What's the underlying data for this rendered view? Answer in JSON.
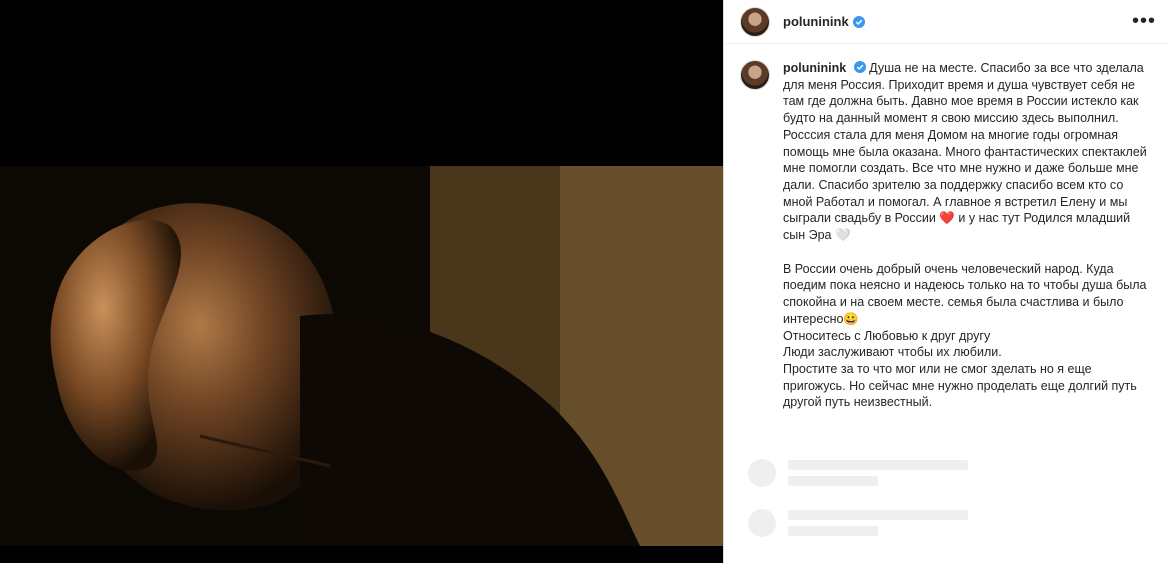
{
  "header": {
    "username": "poluninink",
    "more_icon": "more-horizontal-icon"
  },
  "caption": {
    "username": "poluninink",
    "paragraph1": "Душа не на месте. Спасибо за все что зделала для меня Россия. Приходит время и душа чувствует себя не там где должна быть. Давно мое время в России истекло как будто на данный момент я свою миссию здесь выполнил. Росссия стала для меня Домом на многие годы огромная помощь мне была оказана. Много фантастических спектаклей мне помогли создать. Все что мне нужно и даже больше мне дали. Спасибо зрителю за поддержку спасибо всем кто со мной Работал и помогал. А главное я встретил Елену и мы сыграли свадьбу в России ❤️ и у нас тут Родился младший сын Эра 🤍",
    "paragraph2a": "В России очень добрый очень человеческий народ. Куда поедим пока неясно и надеюсь только на то чтобы душа была спокойна и на своем месте. семья была счастлива и было интересно😀",
    "line_love": "Относитесь с Любовью к друг другу",
    "line_people": "Люди заслуживают чтобы их любили.",
    "paragraph3": "Простите за то что мог или не смог зделать но я еще пригожусь. Но сейчас мне нужно проделать еще долгий путь другой путь неизвестный."
  },
  "colors": {
    "verified": "#3897f0",
    "text": "#262626",
    "skeleton": "#efefef"
  }
}
